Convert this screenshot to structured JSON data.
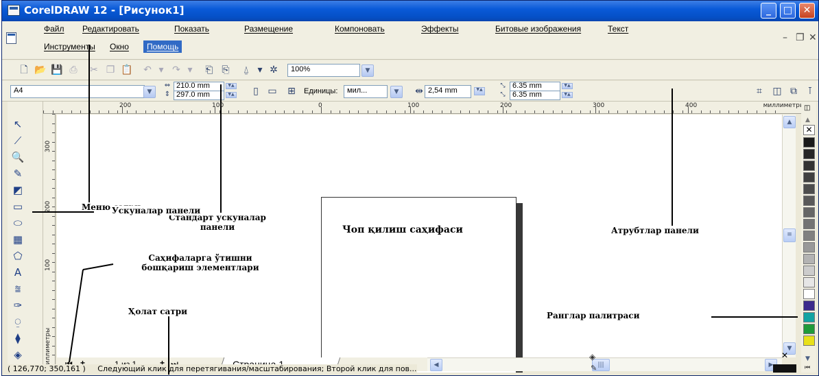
{
  "window": {
    "title": "CorelDRAW 12 - [Рисунок1]",
    "controls": [
      "minimize",
      "maximize",
      "close"
    ]
  },
  "menu": {
    "row1": [
      "Файл",
      "Редактировать",
      "Показать",
      "Размещение",
      "Компоновать",
      "Эффекты",
      "Битовые изображения",
      "Текст"
    ],
    "row2": [
      "Инструменты",
      "Окно",
      "Помощь"
    ],
    "active": "Помощь"
  },
  "standard_toolbar": {
    "zoom_value": "100%"
  },
  "property_bar": {
    "paper_size": "A4",
    "width": "210.0 mm",
    "height": "297.0 mm",
    "units_label": "Единицы:",
    "units_value": "мил...",
    "nudge": "2,54 mm",
    "dup_x": "6.35 mm",
    "dup_y": "6.35 mm"
  },
  "ruler": {
    "h_labels": [
      "200",
      "100",
      "0",
      "100",
      "200",
      "300",
      "400"
    ],
    "h_units": "миллиметры",
    "v_labels": [
      "300",
      "200",
      "100"
    ],
    "v_units": "миллиметры"
  },
  "page_nav": {
    "counter": "1 из 1",
    "tab": "Страница 1"
  },
  "status": {
    "coordinates": "( 126,770; 350,161 )",
    "message": "Следующий клик для перетягивания/масштабирования; Второй клик для пов..."
  },
  "annotations": {
    "menu_row": "Меню сатри",
    "standard_toolbar": "Стандарт ускуналар панели",
    "attributes_panel": "Атрубтлар панели",
    "print_page": "Чоп қилиш саҳифаси",
    "toolbox": "Ускуналар панели",
    "page_nav": "Саҳифаларга ўтишни бошқариш элементлари",
    "status_row": "Ҳолат сатри",
    "palette": "Ранглар палитраси"
  },
  "palette_colors": [
    "#1a1a1a",
    "#262626",
    "#333333",
    "#404040",
    "#4d4d4d",
    "#595959",
    "#666666",
    "#737373",
    "#808080",
    "#999999",
    "#b3b3b3",
    "#cccccc",
    "#e6e6e6",
    "#ffffff",
    "#3b2a8c",
    "#12a3a3",
    "#1f9a3a",
    "#e8e01a"
  ]
}
